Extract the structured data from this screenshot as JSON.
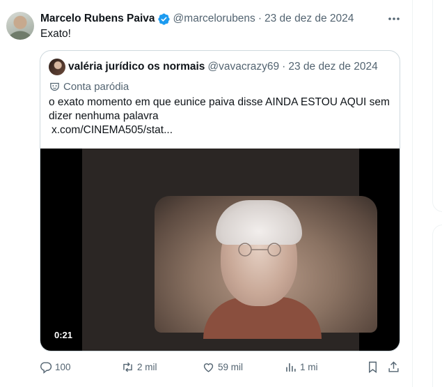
{
  "tweet": {
    "author_name": "Marcelo Rubens Paiva",
    "handle": "@marcelorubens",
    "separator": "·",
    "date": "23 de dez de 2024",
    "text": "Exato!"
  },
  "quoted_tweet": {
    "author_name": "valéria jurídico os normais",
    "handle": "@vavacrazy69",
    "separator": "·",
    "date": "23 de dez de 2024",
    "parody_label": "Conta paródia",
    "text": "o exato momento em que eunice paiva disse AINDA ESTOU AQUI sem dizer nenhuma palavra",
    "link": "x.com/CINEMA505/stat...",
    "video_timestamp": "0:21"
  },
  "actions": {
    "replies": "100",
    "reposts": "2 mil",
    "likes": "59 mil",
    "views": "1 mi"
  },
  "icons": {
    "verified": "verified-badge-icon",
    "more": "more-options-icon",
    "parody": "theater-mask-icon",
    "reply": "reply-icon",
    "repost": "repost-icon",
    "like": "heart-icon",
    "views": "views-chart-icon",
    "bookmark": "bookmark-icon",
    "share": "share-icon"
  },
  "colors": {
    "verified": "#1d9bf0",
    "secondary_text": "#536471",
    "primary_text": "#0f1419",
    "border": "#cfd9de"
  }
}
